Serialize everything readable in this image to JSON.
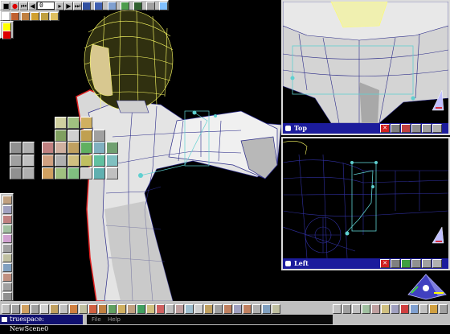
{
  "toolbar": {
    "frame_value": "0",
    "play_icon": "play-icon"
  },
  "views": [
    {
      "label": "Top"
    },
    {
      "label": "Left"
    }
  ],
  "status": {
    "app_title": "truespace: NewScene0"
  },
  "menu": {
    "items": [
      "File",
      "Help"
    ]
  },
  "colors": {
    "background": "#000000",
    "panel": "#c0c0c0",
    "title_bar": "#1c1c9c",
    "mesh_light": "#e0e0e0",
    "wire": "#2a2a88",
    "selection": "#ffff66",
    "accent_red": "#e02020"
  }
}
